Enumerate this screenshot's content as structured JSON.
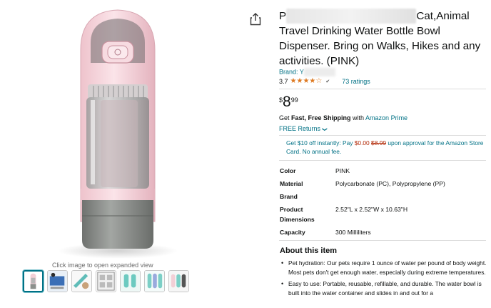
{
  "gallery": {
    "hint": "Click image to open expanded view",
    "thumbnails": [
      "thumb-1",
      "thumb-2",
      "thumb-3",
      "thumb-4",
      "thumb-5",
      "thumb-6",
      "thumb-7"
    ]
  },
  "product": {
    "title_visible_start": "P",
    "title_visible_mid": "Cat,Animal",
    "title_rest": "Travel Drinking Water Bottle Bowl Dispenser. Bring on Walks, Hikes and any activities. (PINK)",
    "brand_prefix": "Brand: Y",
    "rating_value": "3.7",
    "stars": "★★★★☆",
    "ratings_count": "73 ratings",
    "price_currency": "$",
    "price_whole": "8",
    "price_fraction": "99",
    "shipping_pre": "Get ",
    "shipping_bold": "Fast, Free Shipping",
    "shipping_mid": " with ",
    "shipping_link": "Amazon Prime",
    "returns": "FREE Returns",
    "returns_chevron": "❯",
    "promo_pre": "Get $10 off instantly: Pay ",
    "promo_price": "$0.00",
    "promo_old": "$8.99",
    "promo_post": " upon approval for the Amazon Store Card. No annual fee."
  },
  "specs": [
    {
      "key": "Color",
      "value": "PINK"
    },
    {
      "key": "Material",
      "value": "Polycarbonate (PC), Polypropylene (PP)"
    },
    {
      "key": "Brand",
      "value": ""
    },
    {
      "key": "Product Dimensions",
      "value": "2.52\"L x 2.52\"W x 10.63\"H"
    },
    {
      "key": "Capacity",
      "value": "300 Milliliters"
    }
  ],
  "about": {
    "title": "About this item",
    "bullets": [
      "Pet hydration: Our pets require 1 ounce of water per pound of body weight. Most pets don't get enough water, especially during extreme temperatures.",
      "Easy to use: Portable, reusable, refillable, and durable. The water bowl is built into the water container and slides in and out for a"
    ]
  },
  "colors": {
    "link": "#007185",
    "star": "#de7921",
    "price_red": "#b12704",
    "bottle_pink": "#f3cfd6",
    "bottle_gray": "#8c8f8c"
  }
}
